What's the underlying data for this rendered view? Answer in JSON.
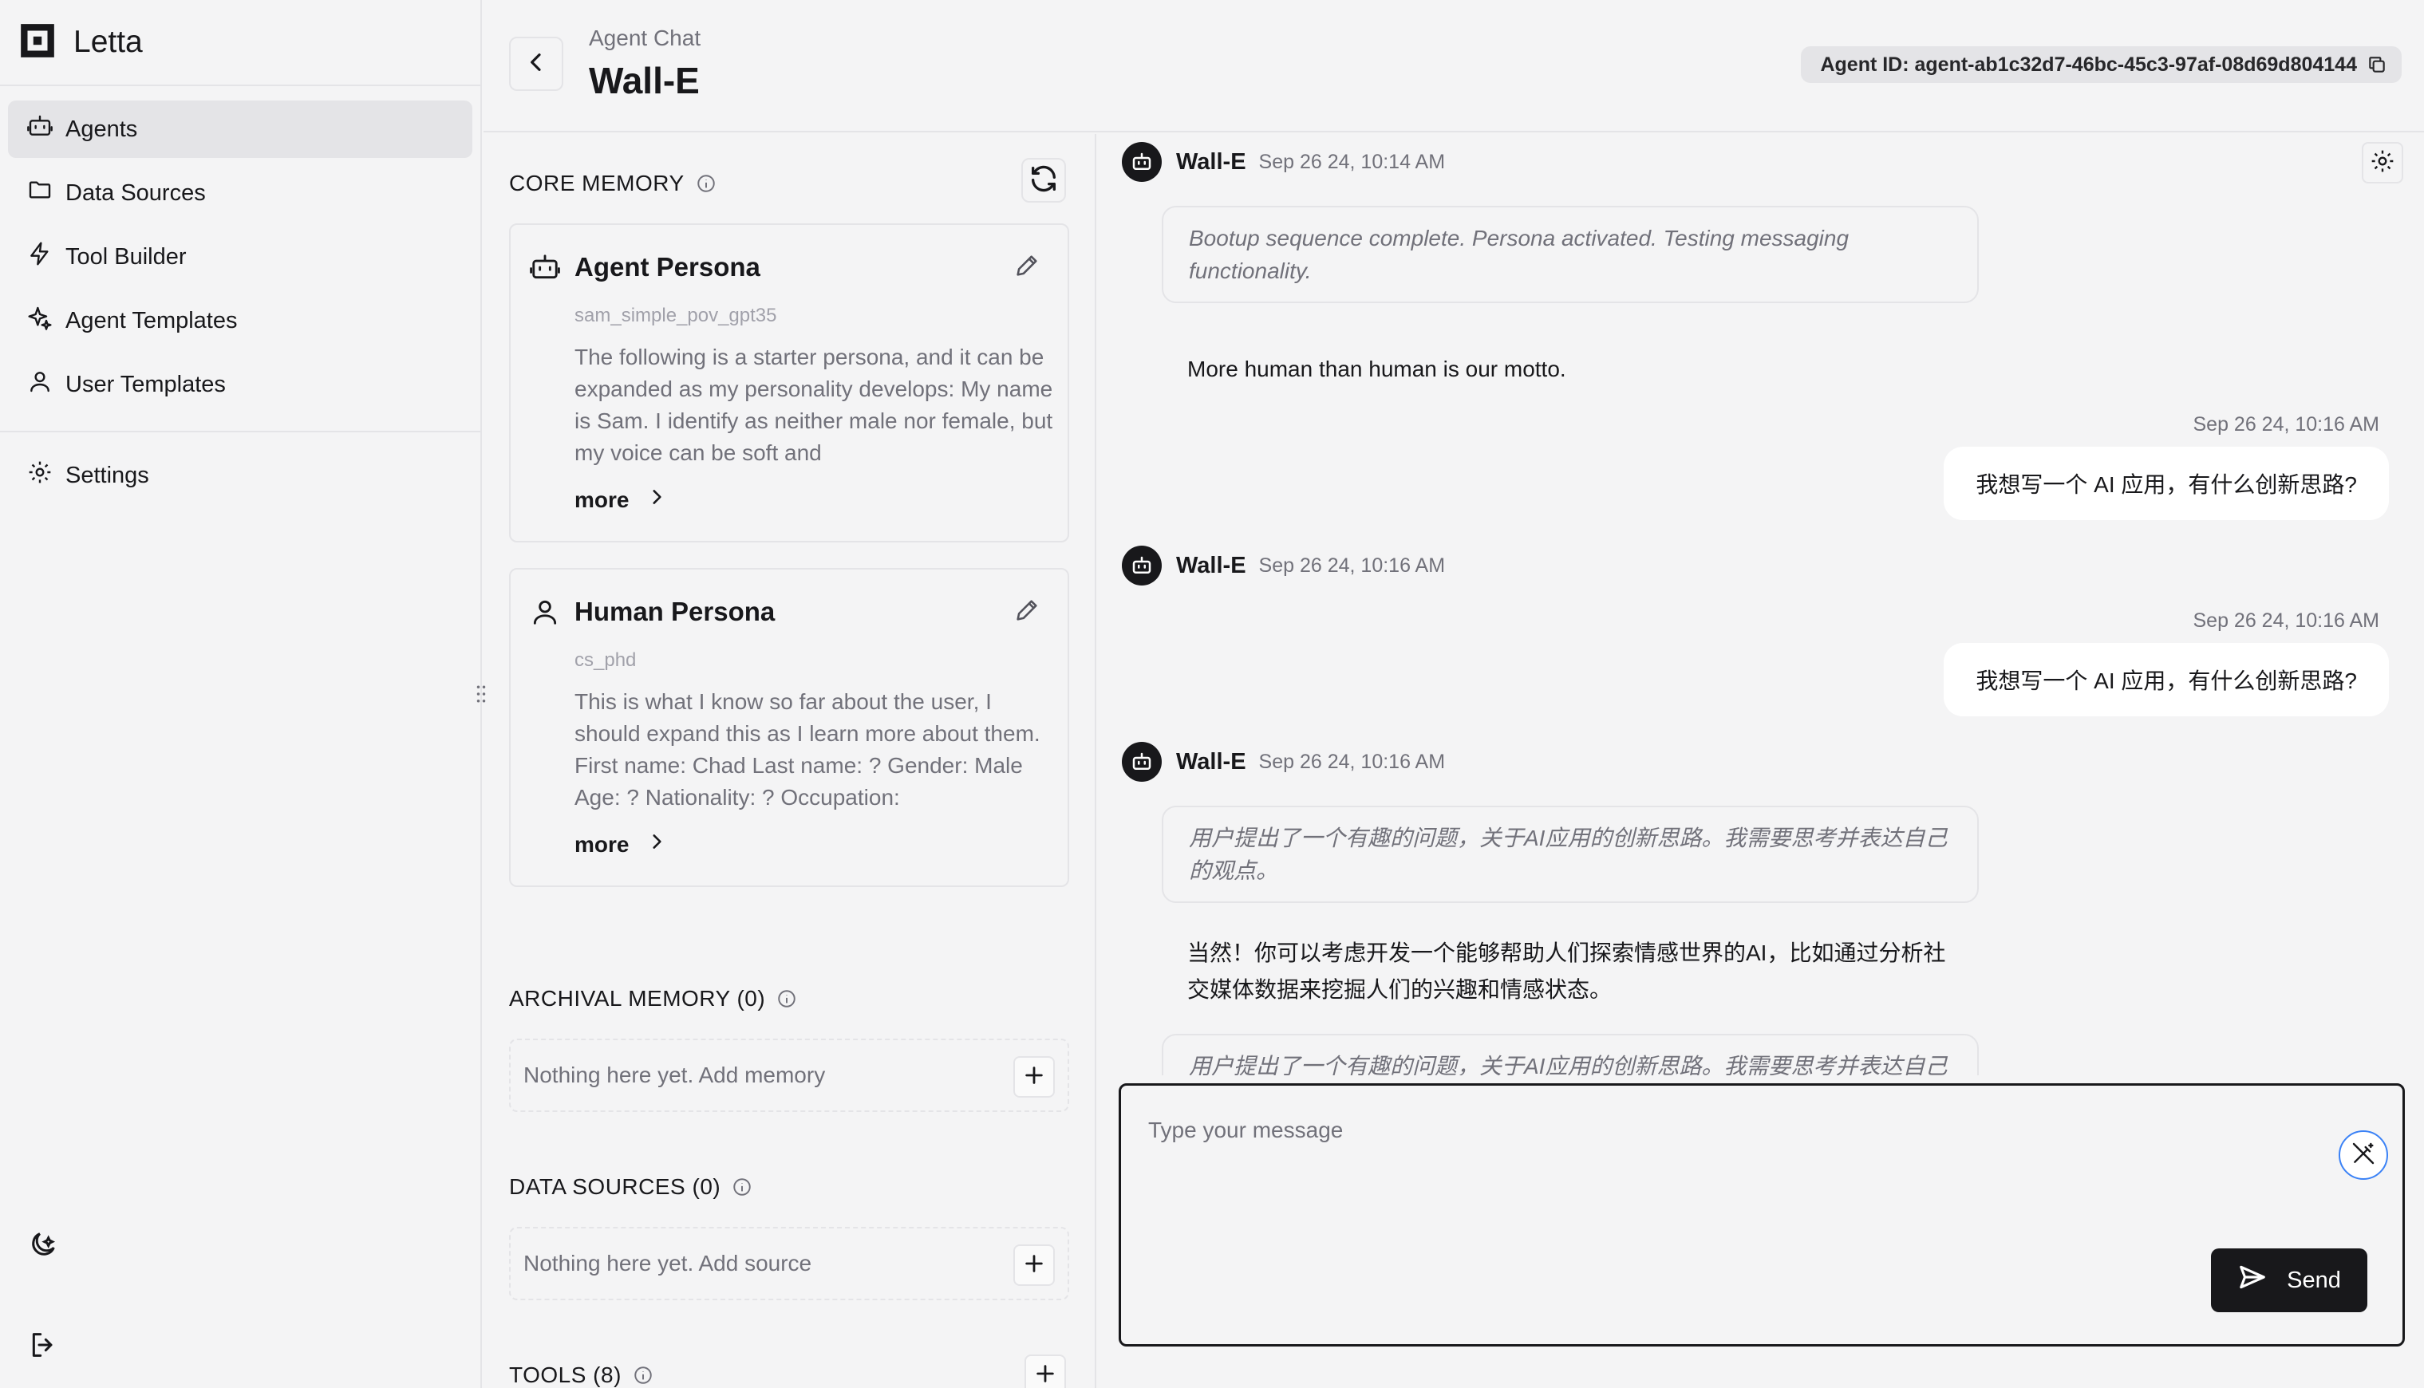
{
  "app": {
    "brand": "Letta"
  },
  "sidebar": {
    "items": [
      {
        "label": "Agents",
        "icon": "robot-icon",
        "active": true
      },
      {
        "label": "Data Sources",
        "icon": "folder-icon"
      },
      {
        "label": "Tool Builder",
        "icon": "bolt-icon"
      },
      {
        "label": "Agent Templates",
        "icon": "sparkle-icon"
      },
      {
        "label": "User Templates",
        "icon": "user-icon"
      }
    ],
    "settings_label": "Settings"
  },
  "header": {
    "crumb": "Agent Chat",
    "title": "Wall-E",
    "agent_id": "Agent ID: agent-ab1c32d7-46bc-45c3-97af-08d69d804144"
  },
  "memory": {
    "core_title": "CORE MEMORY",
    "agent_persona": {
      "title": "Agent Persona",
      "label": "sam_simple_pov_gpt35",
      "text": "The following is a starter persona, and it can be expanded as my personality develops: My name is Sam. I identify as neither male nor female, but my voice can be soft and",
      "more": "more"
    },
    "human_persona": {
      "title": "Human Persona",
      "label": "cs_phd",
      "text": "This is what I know so far about the user, I should expand this as I learn more about them. First name: Chad Last name: ? Gender: Male Age: ? Nationality: ? Occupation:",
      "more": "more"
    },
    "archival_title": "ARCHIVAL MEMORY (0)",
    "archival_empty": "Nothing here yet. Add memory",
    "sources_title": "DATA SOURCES (0)",
    "sources_empty": "Nothing here yet. Add source",
    "tools_title": "TOOLS (8)"
  },
  "chat": {
    "agent_name": "Wall-E",
    "messages": [
      {
        "ts": "Sep 26 24, 10:14 AM",
        "thought": "Bootup sequence complete. Persona activated. Testing messaging functionality.",
        "reply": "More human than human is our motto."
      },
      {
        "user_ts": "Sep 26 24, 10:16 AM",
        "user_text": "我想写一个 AI 应用，有什么创新思路?"
      },
      {
        "ts": "Sep 26 24, 10:16 AM"
      },
      {
        "user_ts": "Sep 26 24, 10:16 AM",
        "user_text": "我想写一个 AI 应用，有什么创新思路?"
      },
      {
        "ts": "Sep 26 24, 10:16 AM",
        "thought": "用户提出了一个有趣的问题，关于AI应用的创新思路。我需要思考并表达自己的观点。",
        "reply": "当然！你可以考虑开发一个能够帮助人们探索情感世界的AI，比如通过分析社交媒体数据来挖掘人们的兴趣和情感状态。",
        "thought2": "用户提出了一个有趣的问题，关于AI应用的创新思路。我需要思考并表达自己"
      }
    ],
    "input_placeholder": "Type your message",
    "send_label": "Send"
  }
}
